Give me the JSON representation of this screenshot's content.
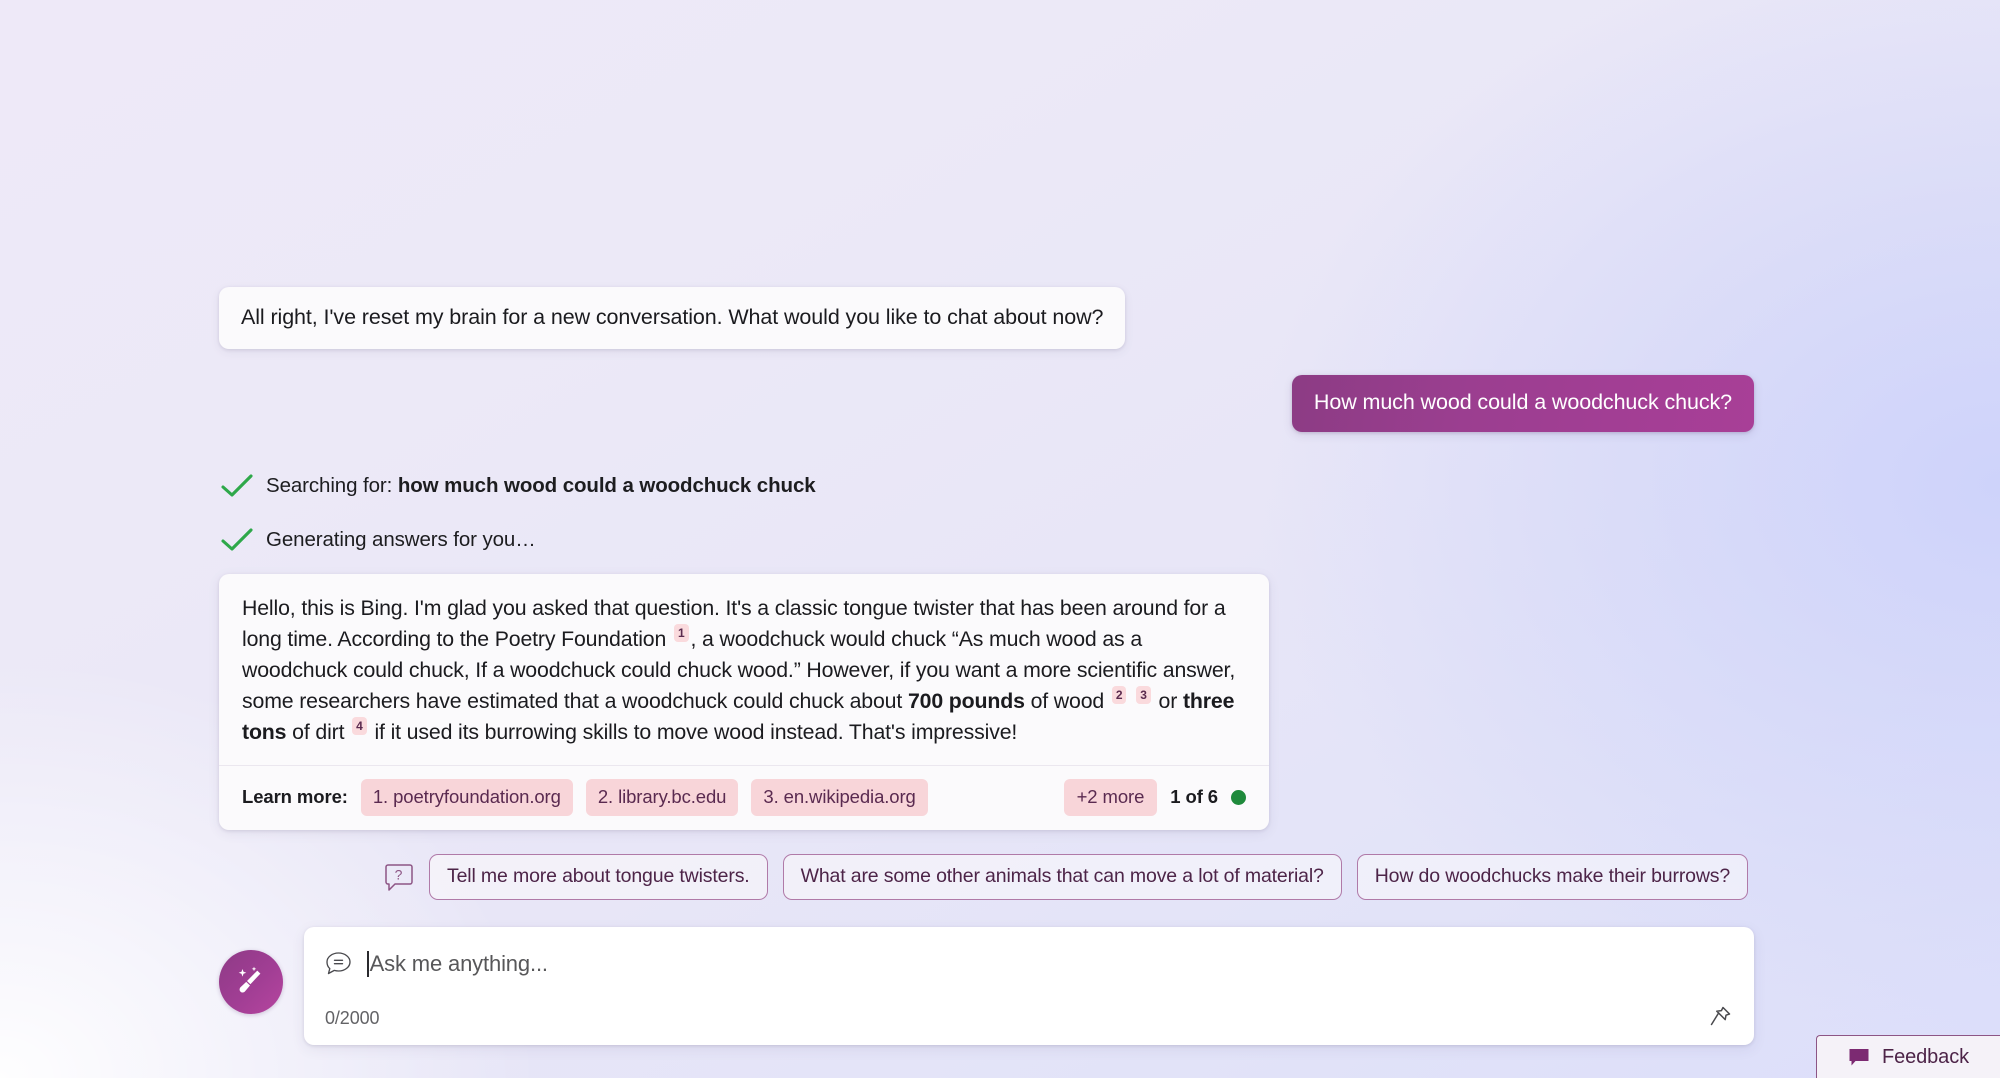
{
  "theme": {
    "accent_purple": "#a23e94",
    "chip_pink": "#f8d5d9",
    "chip_text": "#5a2a50",
    "check_green": "#2ea84a",
    "status_dot_green": "#1f8a3c",
    "bg_left": "#eee9f8",
    "bg_right": "#dcdefa"
  },
  "conversation": {
    "bot_intro": "All right, I've reset my brain for a new conversation. What would you like to chat about now?",
    "user_message": "How much wood could a woodchuck chuck?",
    "status": [
      {
        "icon": "check-icon",
        "prefix": "Searching for: ",
        "bold": "how much wood could a woodchuck chuck"
      },
      {
        "icon": "check-icon",
        "prefix": "Generating answers for you…",
        "bold": ""
      }
    ],
    "answer": {
      "part1": "Hello, this is Bing. I'm glad you asked that question. It's a classic tongue twister that has been around for a long time. According to the Poetry Foundation",
      "cite1": "1",
      "part2": ", a woodchuck would chuck “As much wood as a woodchuck could chuck, If a woodchuck could chuck wood.” However, if you want a more scientific answer, some researchers have estimated that a woodchuck could chuck about",
      "bold1": "700 pounds",
      "part3": "of wood",
      "cite2": "2",
      "cite3": "3",
      "part4": "or",
      "bold2": "three tons",
      "part5": "of dirt",
      "cite4": "4",
      "part6": "if it used its burrowing skills to move wood instead. That's impressive!"
    },
    "footer": {
      "learn_more_label": "Learn more:",
      "sources": [
        "1. poetryfoundation.org",
        "2. library.bc.edu",
        "3. en.wikipedia.org"
      ],
      "more_label": "+2 more",
      "page_count": "1 of 6"
    }
  },
  "suggestions": {
    "icon": "question-bubble-icon",
    "chips": [
      "Tell me more about tongue twisters.",
      "What are some other animals that can move a lot of material?",
      "How do woodchucks make their burrows?"
    ]
  },
  "composer": {
    "new_topic_icon": "broom-sparkle-icon",
    "chat_icon": "chat-bubble-icon",
    "placeholder": "Ask me anything...",
    "value": "",
    "char_count": "0/2000",
    "pin_icon": "pin-icon"
  },
  "feedback": {
    "icon": "speech-bubble-icon",
    "label": "Feedback"
  }
}
